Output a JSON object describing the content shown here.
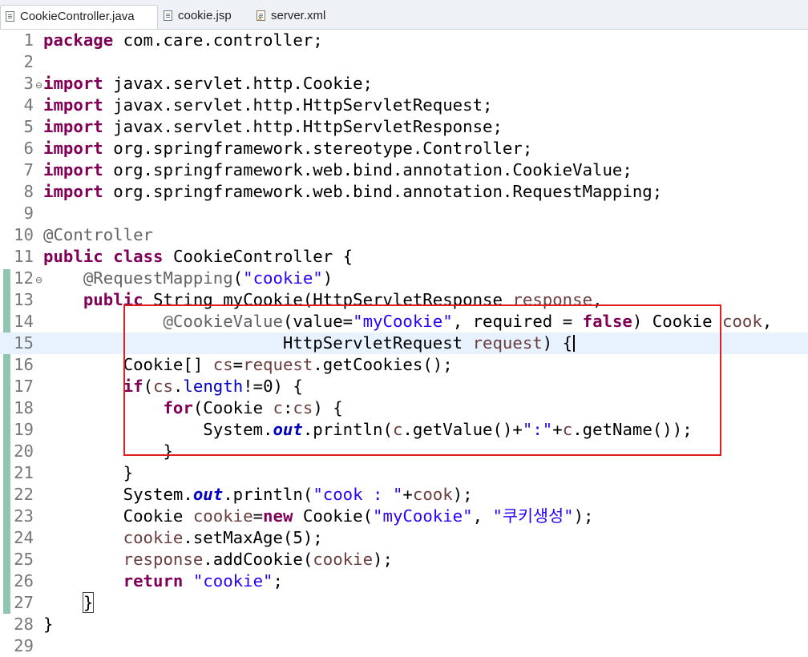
{
  "tabs": [
    {
      "label": "CookieController.java",
      "icon": "java-file-icon",
      "active": true
    },
    {
      "label": "cookie.jsp",
      "icon": "jsp-file-icon",
      "active": false
    },
    {
      "label": "server.xml",
      "icon": "xml-file-icon",
      "active": false
    }
  ],
  "editor": {
    "current_line": 15,
    "highlight": {
      "from_line": 15,
      "to_line": 21,
      "color": "#e01e1e"
    },
    "lines": [
      {
        "n": "1",
        "tokens": [
          [
            "kw",
            "package"
          ],
          [
            "pl",
            " com.care.controller;"
          ]
        ]
      },
      {
        "n": "2",
        "tokens": []
      },
      {
        "n": "3",
        "fold": true,
        "tokens": [
          [
            "kw",
            "import"
          ],
          [
            "pl",
            " javax.servlet.http.Cookie;"
          ]
        ]
      },
      {
        "n": "4",
        "tokens": [
          [
            "kw",
            "import"
          ],
          [
            "pl",
            " javax.servlet.http.HttpServletRequest;"
          ]
        ]
      },
      {
        "n": "5",
        "tokens": [
          [
            "kw",
            "import"
          ],
          [
            "pl",
            " javax.servlet.http.HttpServletResponse;"
          ]
        ]
      },
      {
        "n": "6",
        "tokens": [
          [
            "kw",
            "import"
          ],
          [
            "pl",
            " org.springframework.stereotype.Controller;"
          ]
        ]
      },
      {
        "n": "7",
        "tokens": [
          [
            "kw",
            "import"
          ],
          [
            "pl",
            " org.springframework.web.bind.annotation.CookieValue;"
          ]
        ]
      },
      {
        "n": "8",
        "tokens": [
          [
            "kw",
            "import"
          ],
          [
            "pl",
            " org.springframework.web.bind.annotation.RequestMapping;"
          ]
        ]
      },
      {
        "n": "9",
        "tokens": []
      },
      {
        "n": "10",
        "tokens": [
          [
            "ann",
            "@Controller"
          ]
        ]
      },
      {
        "n": "11",
        "tokens": [
          [
            "kw",
            "public"
          ],
          [
            "pl",
            " "
          ],
          [
            "kw",
            "class"
          ],
          [
            "pl",
            " CookieController {"
          ]
        ]
      },
      {
        "n": "12",
        "fold": true,
        "tokens": [
          [
            "pl",
            "    "
          ],
          [
            "ann",
            "@RequestMapping"
          ],
          [
            "pl",
            "("
          ],
          [
            "str",
            "\"cookie\""
          ],
          [
            "pl",
            ")"
          ]
        ]
      },
      {
        "n": "13",
        "tokens": [
          [
            "pl",
            "    "
          ],
          [
            "kw",
            "public"
          ],
          [
            "pl",
            " String myCookie(HttpServletResponse "
          ],
          [
            "var",
            "response"
          ],
          [
            "pl",
            ","
          ]
        ]
      },
      {
        "n": "14",
        "tokens": [
          [
            "pl",
            "            "
          ],
          [
            "ann",
            "@CookieValue"
          ],
          [
            "pl",
            "(value="
          ],
          [
            "str",
            "\"myCookie\""
          ],
          [
            "pl",
            ", required = "
          ],
          [
            "kw",
            "false"
          ],
          [
            "pl",
            ") Cookie "
          ],
          [
            "var",
            "cook"
          ],
          [
            "pl",
            ","
          ]
        ]
      },
      {
        "n": "15",
        "caret": true,
        "tokens": [
          [
            "pl",
            "                        HttpServletRequest "
          ],
          [
            "var",
            "request"
          ],
          [
            "pl",
            ") {"
          ]
        ]
      },
      {
        "n": "16",
        "tokens": [
          [
            "pl",
            "        Cookie[] "
          ],
          [
            "var",
            "cs"
          ],
          [
            "pl",
            "="
          ],
          [
            "var",
            "request"
          ],
          [
            "pl",
            ".getCookies();"
          ]
        ]
      },
      {
        "n": "17",
        "tokens": [
          [
            "pl",
            "        "
          ],
          [
            "kw",
            "if"
          ],
          [
            "pl",
            "("
          ],
          [
            "var",
            "cs"
          ],
          [
            "pl",
            "."
          ],
          [
            "fld",
            "length"
          ],
          [
            "pl",
            "!=0) {"
          ]
        ]
      },
      {
        "n": "18",
        "tokens": [
          [
            "pl",
            "            "
          ],
          [
            "kw",
            "for"
          ],
          [
            "pl",
            "(Cookie "
          ],
          [
            "var",
            "c"
          ],
          [
            "pl",
            ":"
          ],
          [
            "var",
            "cs"
          ],
          [
            "pl",
            ") {"
          ]
        ]
      },
      {
        "n": "19",
        "tokens": [
          [
            "pl",
            "                System."
          ],
          [
            "sfld",
            "out"
          ],
          [
            "pl",
            ".println("
          ],
          [
            "var",
            "c"
          ],
          [
            "pl",
            ".getValue()+"
          ],
          [
            "str",
            "\":\""
          ],
          [
            "pl",
            "+"
          ],
          [
            "var",
            "c"
          ],
          [
            "pl",
            ".getName());"
          ]
        ]
      },
      {
        "n": "20",
        "tokens": [
          [
            "pl",
            "            }"
          ]
        ]
      },
      {
        "n": "21",
        "tokens": [
          [
            "pl",
            "        }"
          ]
        ]
      },
      {
        "n": "22",
        "tokens": [
          [
            "pl",
            "        System."
          ],
          [
            "sfld",
            "out"
          ],
          [
            "pl",
            ".println("
          ],
          [
            "str",
            "\"cook : \""
          ],
          [
            "pl",
            "+"
          ],
          [
            "var",
            "cook"
          ],
          [
            "pl",
            ");"
          ]
        ]
      },
      {
        "n": "23",
        "tokens": [
          [
            "pl",
            "        Cookie "
          ],
          [
            "var",
            "cookie"
          ],
          [
            "pl",
            "="
          ],
          [
            "kw",
            "new"
          ],
          [
            "pl",
            " Cookie("
          ],
          [
            "str",
            "\"myCookie\""
          ],
          [
            "pl",
            ", "
          ],
          [
            "str",
            "\"쿠키생성\""
          ],
          [
            "pl",
            ");"
          ]
        ]
      },
      {
        "n": "24",
        "tokens": [
          [
            "pl",
            "        "
          ],
          [
            "var",
            "cookie"
          ],
          [
            "pl",
            ".setMaxAge(5);"
          ]
        ]
      },
      {
        "n": "25",
        "tokens": [
          [
            "pl",
            "        "
          ],
          [
            "var",
            "response"
          ],
          [
            "pl",
            ".addCookie("
          ],
          [
            "var",
            "cookie"
          ],
          [
            "pl",
            ");"
          ]
        ]
      },
      {
        "n": "26",
        "tokens": [
          [
            "pl",
            "        "
          ],
          [
            "kw",
            "return"
          ],
          [
            "pl",
            " "
          ],
          [
            "str",
            "\"cookie\""
          ],
          [
            "pl",
            ";"
          ]
        ]
      },
      {
        "n": "27",
        "tokens": [
          [
            "pl",
            "    "
          ],
          [
            "bm",
            "}"
          ]
        ]
      },
      {
        "n": "28",
        "tokens": [
          [
            "pl",
            "}"
          ]
        ]
      },
      {
        "n": "29",
        "tokens": []
      }
    ]
  }
}
